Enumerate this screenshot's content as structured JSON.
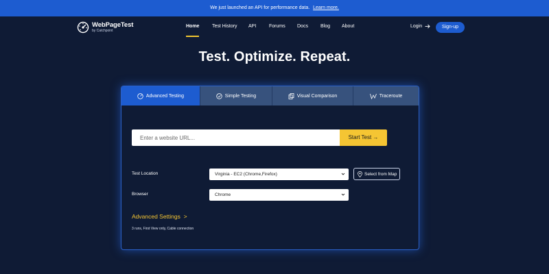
{
  "banner": {
    "text": "We just launched an API for performance data.",
    "link": "Learn more."
  },
  "brand": {
    "title": "WebPageTest",
    "subtitle": "by Catchpoint"
  },
  "nav": {
    "links": [
      {
        "label": "Home",
        "active": true
      },
      {
        "label": "Test History"
      },
      {
        "label": "API"
      },
      {
        "label": "Forums"
      },
      {
        "label": "Docs"
      },
      {
        "label": "Blog"
      },
      {
        "label": "About"
      }
    ],
    "login": "Login",
    "signup": "Sign-up"
  },
  "hero": {
    "title": "Test. Optimize. Repeat."
  },
  "tabs": [
    {
      "label": "Advanced Testing",
      "icon": "gauge-icon",
      "active": true
    },
    {
      "label": "Simple Testing",
      "icon": "check-circle-icon"
    },
    {
      "label": "Visual Comparison",
      "icon": "copy-icon"
    },
    {
      "label": "Traceroute",
      "icon": "traceroute-icon"
    }
  ],
  "form": {
    "url_placeholder": "Enter a website URL...",
    "start_label": "Start Test →",
    "location_label": "Test Location",
    "location_value": "Virginia - EC2 (Chrome,Firefox)",
    "map_button": "Select from Map",
    "browser_label": "Browser",
    "browser_value": "Chrome",
    "advanced_label": "Advanced Settings  >",
    "advanced_summary": "3 runs, First View only, Cable connection"
  },
  "colors": {
    "background": "#0f1b35",
    "accent": "#1d5cd0",
    "button": "#f5c533",
    "tab": "#37527d"
  }
}
